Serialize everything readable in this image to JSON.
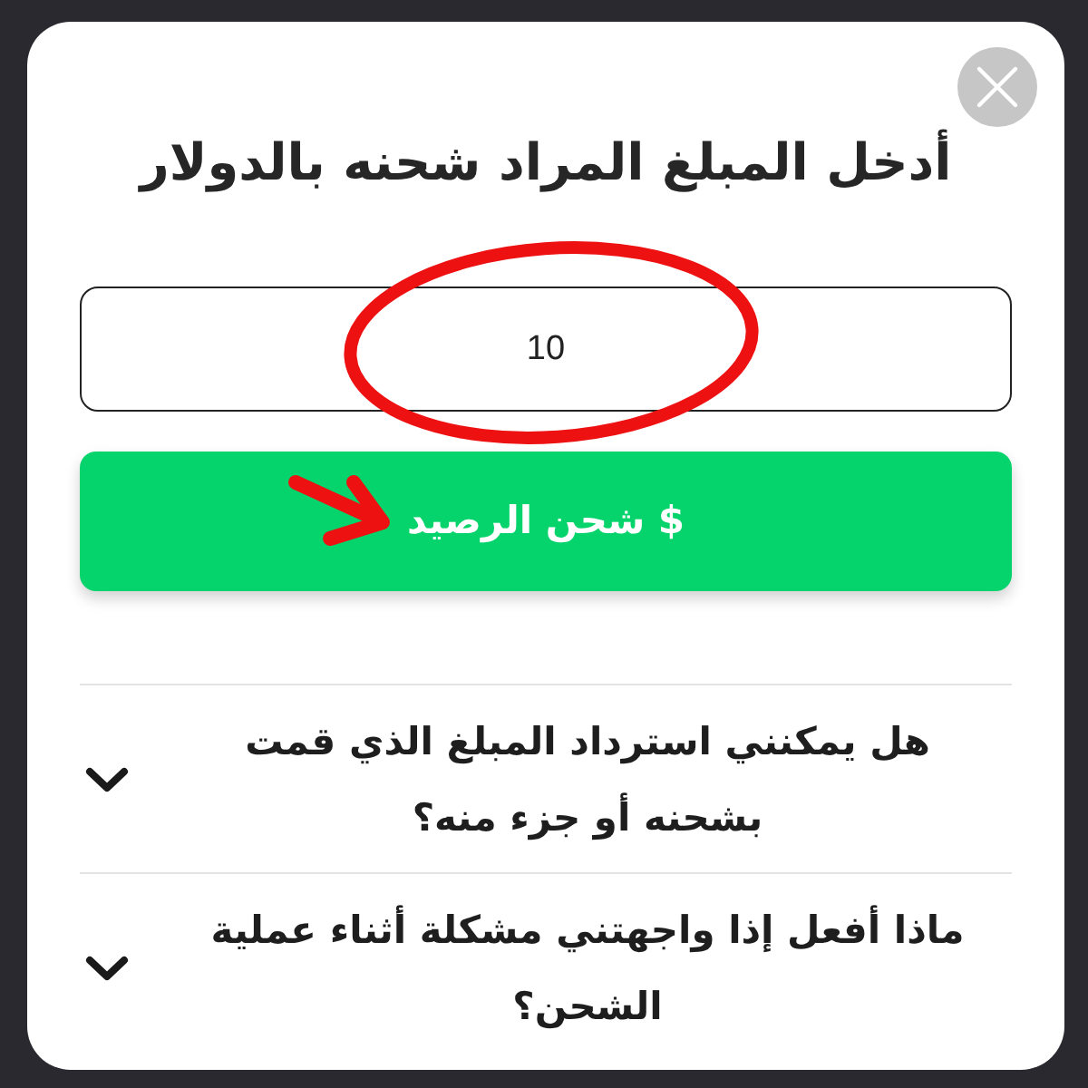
{
  "dialog": {
    "title": "أدخل المبلغ المراد شحنه بالدولار",
    "amount_field": {
      "value": "10"
    },
    "submit_button": {
      "label": "$ شحن الرصيد"
    },
    "faq": [
      {
        "question": "هل يمكنني استرداد المبلغ الذي قمت بشحنه أو جزء منه؟",
        "expanded": false
      },
      {
        "question": "ماذا أفعل إذا واجهتني مشكلة أثناء عملية الشحن؟",
        "expanded": false
      }
    ]
  }
}
